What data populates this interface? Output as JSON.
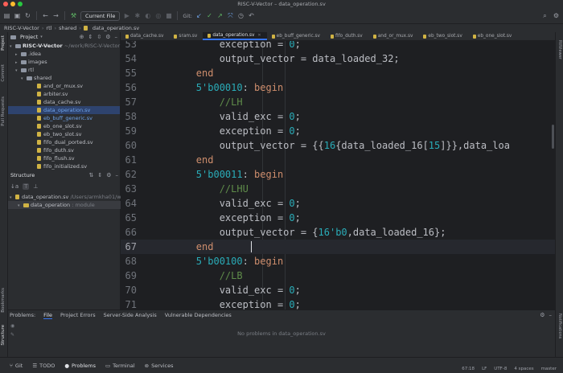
{
  "window": {
    "title": "RISC-V-Vector – data_operation.sv"
  },
  "toolbar": {
    "run_config": "Current File",
    "git_label": "Git:"
  },
  "breadcrumb": [
    "RISC-V-Vector",
    "rtl",
    "shared",
    "data_operation.sv"
  ],
  "project_panel": {
    "title": "Project",
    "root": "RISC-V-Vector",
    "root_path": "~/work/RISC-V-Vector",
    "items": [
      {
        "label": ".idea",
        "kind": "folder"
      },
      {
        "label": "images",
        "kind": "folder"
      },
      {
        "label": "rtl",
        "kind": "folder"
      },
      {
        "label": "shared",
        "kind": "folder"
      },
      {
        "label": "and_or_mux.sv",
        "kind": "file"
      },
      {
        "label": "arbiter.sv",
        "kind": "file"
      },
      {
        "label": "data_cache.sv",
        "kind": "file"
      },
      {
        "label": "data_operation.sv",
        "kind": "file"
      },
      {
        "label": "eb_buff_generic.sv",
        "kind": "file"
      },
      {
        "label": "eb_one_slot.sv",
        "kind": "file"
      },
      {
        "label": "eb_two_slot.sv",
        "kind": "file"
      },
      {
        "label": "fifo_dual_ported.sv",
        "kind": "file"
      },
      {
        "label": "fifo_duth.sv",
        "kind": "file"
      },
      {
        "label": "fifo_flush.sv",
        "kind": "file"
      },
      {
        "label": "fifo_initialized.sv",
        "kind": "file"
      }
    ]
  },
  "structure_panel": {
    "title": "Structure",
    "file": "data_operation.sv",
    "file_path": "/Users/armkha01/wo",
    "module": "data_operation",
    "module_kind": ": module"
  },
  "tabs": [
    {
      "label": "data_cache.sv"
    },
    {
      "label": "sram.sv"
    },
    {
      "label": "data_operation.sv"
    },
    {
      "label": "eb_buff_generic.sv"
    },
    {
      "label": "fifo_duth.sv"
    },
    {
      "label": "and_or_mux.sv"
    },
    {
      "label": "eb_two_slot.sv"
    },
    {
      "label": "eb_one_slot.sv"
    }
  ],
  "editor": {
    "lines": [
      {
        "n": "53",
        "text": "                    exception = 0;"
      },
      {
        "n": "54",
        "text": "                    output_vector = data_loaded_32;"
      },
      {
        "n": "55",
        "text": "                end"
      },
      {
        "n": "56",
        "text": "                5'b00010: begin"
      },
      {
        "n": "57",
        "text": "                    //LH"
      },
      {
        "n": "58",
        "text": "                    valid_exc = 0;"
      },
      {
        "n": "59",
        "text": "                    exception = 0;"
      },
      {
        "n": "60",
        "text": "                    output_vector = {{16{data_loaded_16[15]}},data_loa"
      },
      {
        "n": "61",
        "text": "                end"
      },
      {
        "n": "62",
        "text": "                5'b00011: begin"
      },
      {
        "n": "63",
        "text": "                    //LHU"
      },
      {
        "n": "64",
        "text": "                    valid_exc = 0;"
      },
      {
        "n": "65",
        "text": "                    exception = 0;"
      },
      {
        "n": "66",
        "text": "                    output_vector = {16'b0,data_loaded_16};"
      },
      {
        "n": "67",
        "text": "                end"
      },
      {
        "n": "68",
        "text": "                5'b00100: begin"
      },
      {
        "n": "69",
        "text": "                    //LB"
      },
      {
        "n": "70",
        "text": "                    valid_exc = 0;"
      },
      {
        "n": "71",
        "text": "                    exception = 0;"
      }
    ]
  },
  "bottom_panel": {
    "tabs": [
      "Problems:",
      "File",
      "Project Errors",
      "Server-Side Analysis",
      "Vulnerable Dependencies"
    ],
    "empty_message": "No problems in data_operation.sv"
  },
  "statusbar": {
    "tools": [
      "Git",
      "TODO",
      "Problems",
      "Terminal",
      "Services"
    ],
    "position": "67:18",
    "line_sep": "LF",
    "encoding": "UTF-8",
    "indent": "4 spaces",
    "branch": "master"
  },
  "strips": {
    "left": [
      "Project",
      "Commit",
      "Pull Requests",
      "Bookmarks",
      "Structure"
    ],
    "right": [
      "Notifications",
      "RtlViewer"
    ]
  },
  "colors": {
    "accent": "#3574f0",
    "keyword": "#cf8e6d",
    "number": "#2aacb8",
    "comment": "#5f8c4a"
  }
}
